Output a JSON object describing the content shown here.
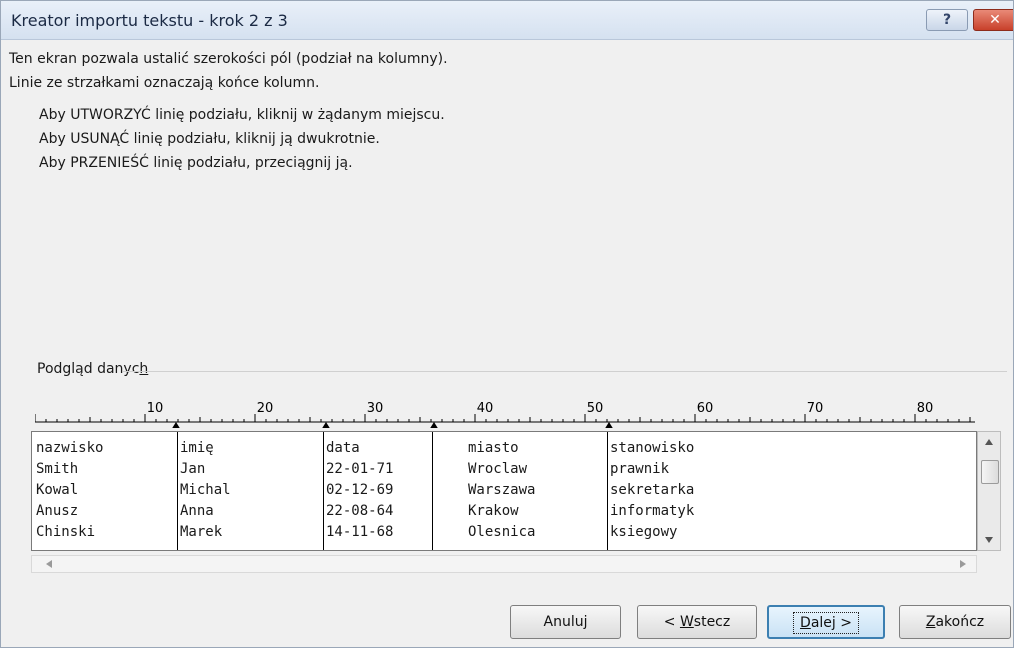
{
  "window": {
    "title": "Kreator importu tekstu - krok 2 z 3",
    "help_glyph": "?",
    "close_glyph": "✕"
  },
  "intro": {
    "line1": "Ten ekran pozwala ustalić szerokości pól (podział na kolumny).",
    "line2": "Linie ze strzałkami oznaczają końce kolumn."
  },
  "instructions": [
    "Aby UTWORZYĆ linię podziału, kliknij w żądanym miejscu.",
    "Aby USUNĄĆ linię podziału, kliknij ją dwukrotnie.",
    "Aby PRZENIEŚĆ linię podziału, przeciągnij ją."
  ],
  "preview": {
    "label_prefix": "Podgląd danyc",
    "label_accel": "h",
    "ruler_numbers": [
      "10",
      "20",
      "30",
      "40",
      "50",
      "60",
      "70",
      "80"
    ],
    "rows": [
      [
        "nazwisko",
        "imię",
        "data",
        "miasto",
        "stanowisko"
      ],
      [
        "Smith",
        "Jan",
        "22-01-71",
        "Wroclaw",
        "prawnik"
      ],
      [
        "Kowal",
        "Michal",
        "02-12-69",
        "Warszawa",
        "sekretarka"
      ],
      [
        "Anusz",
        "Anna",
        "22-08-64",
        "Krakow",
        "informatyk"
      ],
      [
        "Chinski",
        "Marek",
        "14-11-68",
        "Olesnica",
        "ksiegowy"
      ]
    ]
  },
  "buttons": {
    "cancel": "Anuluj",
    "back_prefix": "< ",
    "back_accel": "W",
    "back_rest": "stecz",
    "next_accel": "D",
    "next_rest": "alej >",
    "finish_accel": "Z",
    "finish_rest": "akończ"
  }
}
